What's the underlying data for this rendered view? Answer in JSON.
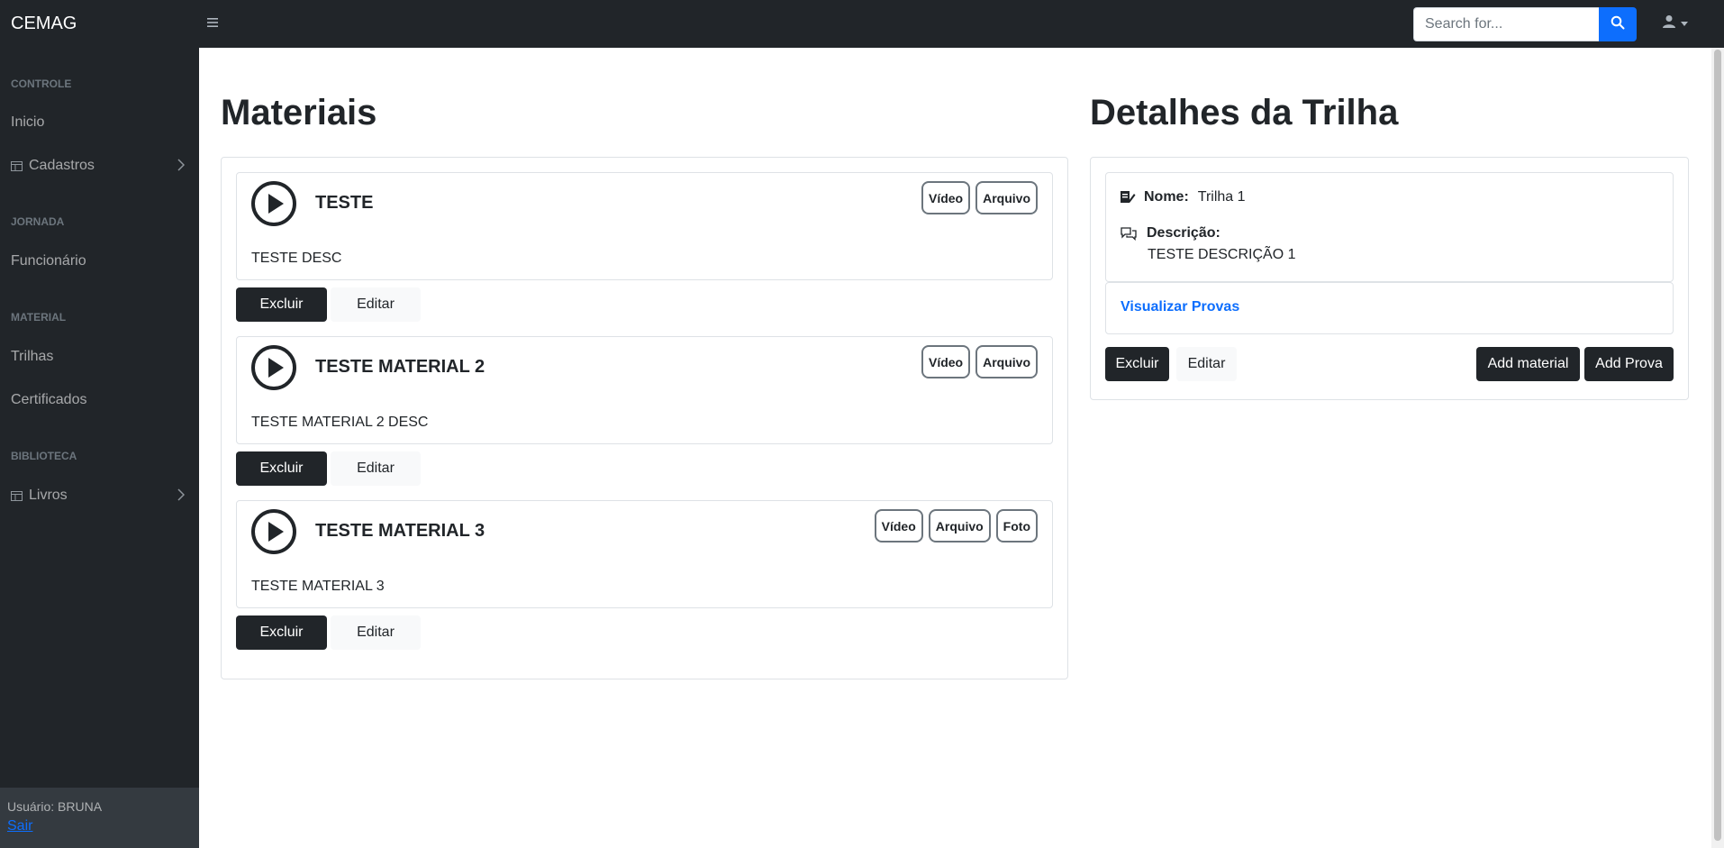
{
  "app": {
    "brand": "CEMAG"
  },
  "search": {
    "placeholder": "Search for..."
  },
  "sidebar": {
    "headings": [
      "CONTROLE",
      "JORNADA",
      "MATERIAL",
      "BIBLIOTECA"
    ],
    "items": [
      {
        "label": "Inicio"
      },
      {
        "label": "Cadastros",
        "icon": "table-icon",
        "expandable": true
      },
      {
        "label": "Funcionário"
      },
      {
        "label": "Trilhas"
      },
      {
        "label": "Certificados"
      },
      {
        "label": "Livros",
        "icon": "table-icon",
        "expandable": true
      }
    ],
    "footer": {
      "user": "Usuário: BRUNA",
      "logout": "Sair"
    }
  },
  "materiais": {
    "title": "Materiais",
    "cards": [
      {
        "title": "TESTE",
        "desc": "TESTE DESC",
        "badges": [
          "Vídeo",
          "Arquivo"
        ]
      },
      {
        "title": "TESTE MATERIAL 2",
        "desc": "TESTE MATERIAL 2 DESC",
        "badges": [
          "Vídeo",
          "Arquivo"
        ]
      },
      {
        "title": "TESTE MATERIAL 3",
        "desc": "TESTE MATERIAL 3",
        "badges": [
          "Vídeo",
          "Arquivo",
          "Foto"
        ]
      }
    ],
    "delete_label": "Excluir",
    "edit_label": "Editar"
  },
  "detalhes": {
    "title": "Detalhes da Trilha",
    "nome_label": "Nome:",
    "nome_value": "Trilha 1",
    "descricao_label": "Descrição:",
    "descricao_value": "TESTE DESCRIÇÃO 1",
    "provas_link": "Visualizar Provas",
    "delete_label": "Excluir",
    "edit_label": "Editar",
    "add_material_label": "Add material",
    "add_prova_label": "Add Prova"
  },
  "colors": {
    "dark": "#212529",
    "primary": "#0d6efd",
    "light": "#f8f9fa"
  }
}
